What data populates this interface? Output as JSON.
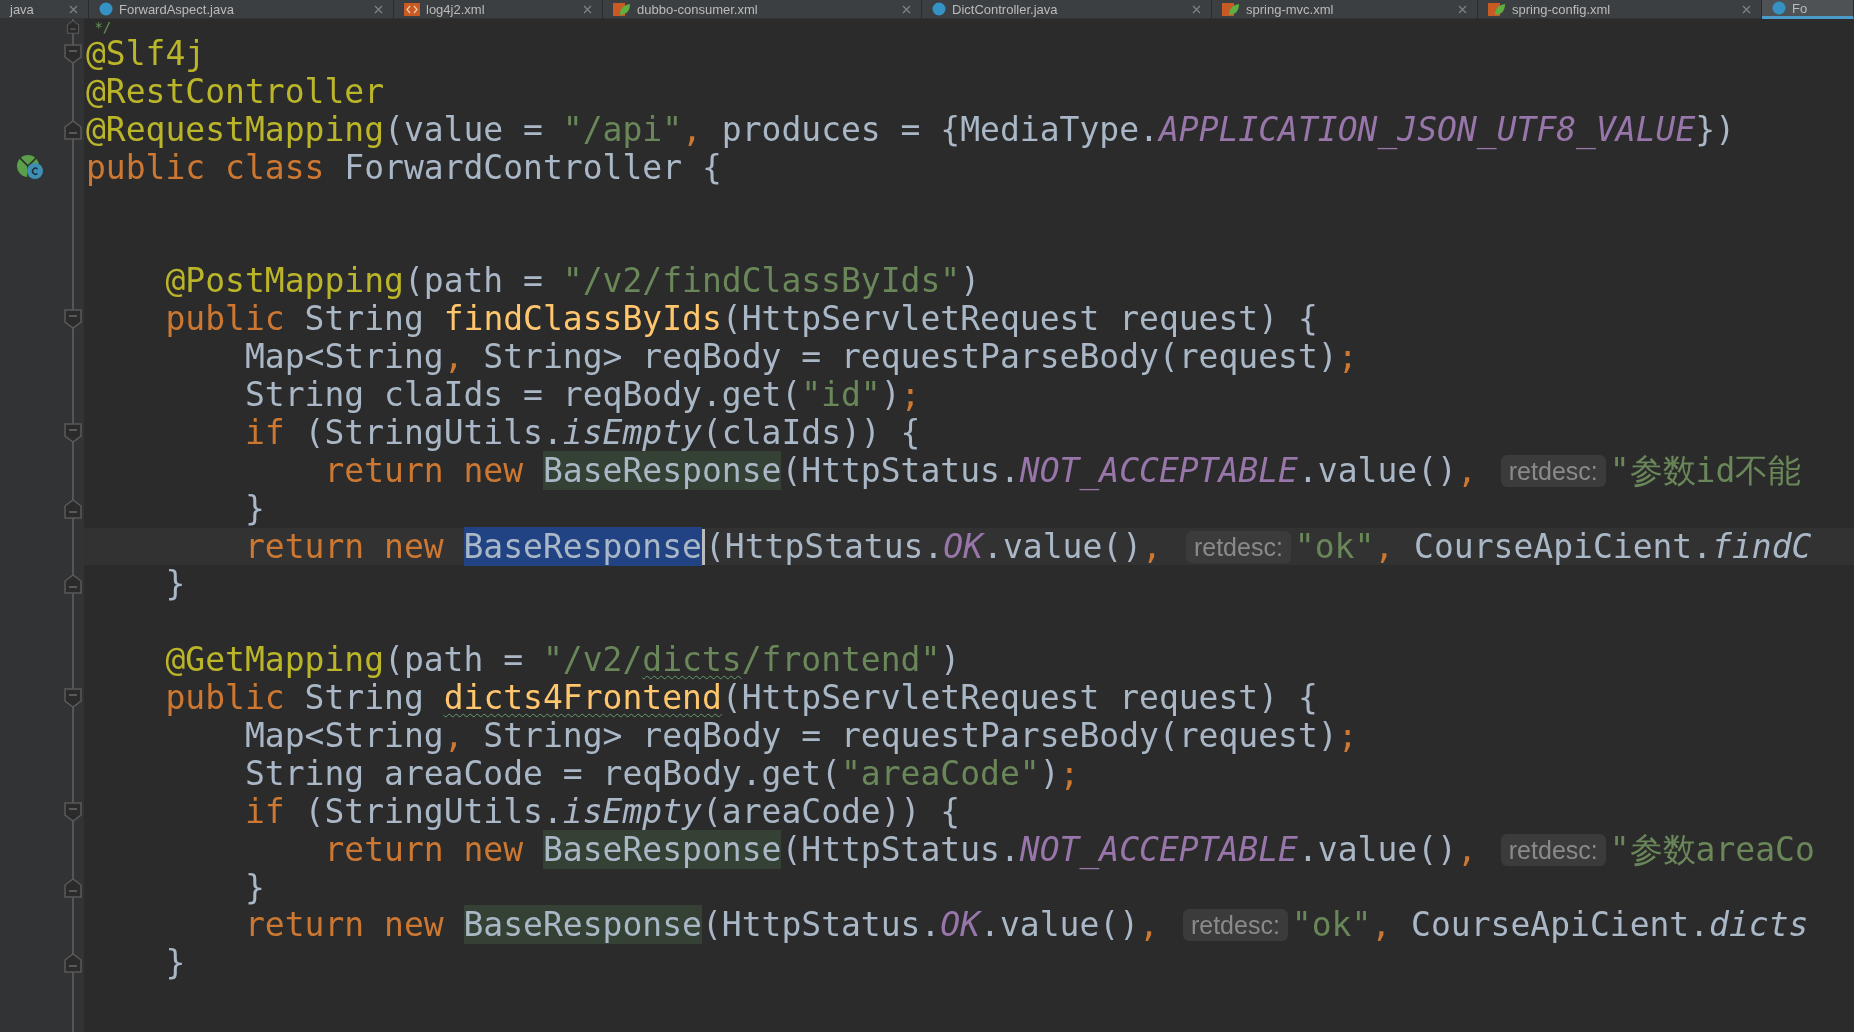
{
  "tabs": [
    {
      "label": "java",
      "kind": "plain",
      "selected": false
    },
    {
      "label": "ForwardAspect.java",
      "kind": "java",
      "selected": false
    },
    {
      "label": "log4j2.xml",
      "kind": "xml",
      "selected": false
    },
    {
      "label": "dubbo-consumer.xml",
      "kind": "spring",
      "selected": false
    },
    {
      "label": "DictController.java",
      "kind": "java",
      "selected": false
    },
    {
      "label": "spring-mvc.xml",
      "kind": "spring",
      "selected": false
    },
    {
      "label": "spring-config.xml",
      "kind": "spring",
      "selected": false
    },
    {
      "label": "Fo",
      "kind": "java",
      "selected": true
    }
  ],
  "lines": [
    {
      "fold_start": false,
      "fold_end": true,
      "class_icon": false,
      "tokens": [
        {
          "kind": "comment",
          "text": " */"
        }
      ]
    },
    {
      "fold_start": true,
      "fold_end": false,
      "class_icon": false,
      "tokens": [
        {
          "kind": "annotation",
          "text": "@Slf4j"
        }
      ]
    },
    {
      "fold_start": false,
      "fold_end": false,
      "class_icon": false,
      "tokens": [
        {
          "kind": "annotation",
          "text": "@RestController"
        }
      ]
    },
    {
      "fold_start": false,
      "fold_end": true,
      "class_icon": false,
      "tokens": [
        {
          "kind": "annotation",
          "text": "@RequestMapping"
        },
        {
          "kind": "plain",
          "text": "(value = "
        },
        {
          "kind": "string",
          "text": "\"/api\""
        },
        {
          "kind": "punct",
          "text": ","
        },
        {
          "kind": "plain",
          "text": " produces = {MediaType."
        },
        {
          "kind": "constant",
          "text": "APPLICATION_JSON_UTF8_VALUE"
        },
        {
          "kind": "plain",
          "text": "})"
        }
      ]
    },
    {
      "fold_start": false,
      "fold_end": false,
      "class_icon": true,
      "tokens": [
        {
          "kind": "keyword",
          "text": "public class"
        },
        {
          "kind": "plain",
          "text": " ForwardController {"
        }
      ]
    },
    {
      "fold_start": false,
      "fold_end": false,
      "class_icon": false
    },
    {
      "fold_start": false,
      "fold_end": false,
      "class_icon": false
    },
    {
      "fold_start": false,
      "fold_end": false,
      "class_icon": false,
      "tokens": [
        {
          "kind": "annotation",
          "text": "    @PostMapping"
        },
        {
          "kind": "plain",
          "text": "(path = "
        },
        {
          "kind": "string",
          "text": "\"/v2/findClassByIds\""
        },
        {
          "kind": "plain",
          "text": ")"
        }
      ]
    },
    {
      "fold_start": true,
      "fold_end": false,
      "class_icon": false,
      "tokens": [
        {
          "kind": "keyword",
          "text": "    public"
        },
        {
          "kind": "plain",
          "text": " String "
        },
        {
          "kind": "method",
          "text": "findClassByIds"
        },
        {
          "kind": "plain",
          "text": "(HttpServletRequest request) {"
        }
      ]
    },
    {
      "fold_start": false,
      "fold_end": false,
      "class_icon": false,
      "tokens": [
        {
          "kind": "plain",
          "text": "        Map<String"
        },
        {
          "kind": "punct",
          "text": ","
        },
        {
          "kind": "plain",
          "text": " String> reqBody = requestParseBody(request)"
        },
        {
          "kind": "punct",
          "text": ";"
        }
      ]
    },
    {
      "fold_start": false,
      "fold_end": false,
      "class_icon": false,
      "tokens": [
        {
          "kind": "plain",
          "text": "        String claIds = reqBody.get("
        },
        {
          "kind": "string",
          "text": "\"id\""
        },
        {
          "kind": "plain",
          "text": ")"
        },
        {
          "kind": "punct",
          "text": ";"
        }
      ]
    },
    {
      "fold_start": true,
      "fold_end": false,
      "class_icon": false,
      "tokens": [
        {
          "kind": "keyword",
          "text": "        if"
        },
        {
          "kind": "plain",
          "text": " (StringUtils."
        },
        {
          "kind": "static",
          "text": "isEmpty"
        },
        {
          "kind": "plain",
          "text": "(claIds)) {"
        }
      ]
    },
    {
      "fold_start": false,
      "fold_end": false,
      "class_icon": false,
      "tokens": [
        {
          "kind": "keyword",
          "text": "            return new "
        },
        {
          "kind": "usage",
          "text": "BaseResponse"
        },
        {
          "kind": "plain",
          "text": "(HttpStatus."
        },
        {
          "kind": "constant",
          "text": "NOT_ACCEPTABLE"
        },
        {
          "kind": "plain",
          "text": ".value()"
        },
        {
          "kind": "punct",
          "text": ","
        },
        {
          "kind": "hint",
          "text": "retdesc:"
        },
        {
          "kind": "string",
          "text": "\"参数id不能"
        }
      ]
    },
    {
      "fold_start": false,
      "fold_end": true,
      "class_icon": false,
      "tokens": [
        {
          "kind": "plain",
          "text": "        }"
        }
      ]
    },
    {
      "fold_start": false,
      "fold_end": false,
      "class_icon": false,
      "current": true,
      "tokens": [
        {
          "kind": "keyword",
          "text": "        return new "
        },
        {
          "kind": "selected",
          "text": "BaseResponse"
        },
        {
          "kind": "plain",
          "text": "(HttpStatus."
        },
        {
          "kind": "constant",
          "text": "OK"
        },
        {
          "kind": "plain",
          "text": ".value()"
        },
        {
          "kind": "punct",
          "text": ","
        },
        {
          "kind": "hint",
          "text": "retdesc:"
        },
        {
          "kind": "string",
          "text": "\"ok\""
        },
        {
          "kind": "punct",
          "text": ","
        },
        {
          "kind": "plain",
          "text": " CourseApiCient."
        },
        {
          "kind": "static",
          "text": "findC"
        }
      ]
    },
    {
      "fold_start": false,
      "fold_end": true,
      "class_icon": false,
      "tokens": [
        {
          "kind": "plain",
          "text": "    }"
        }
      ]
    },
    {
      "fold_start": false,
      "fold_end": false,
      "class_icon": false
    },
    {
      "fold_start": false,
      "fold_end": false,
      "class_icon": false,
      "tokens": [
        {
          "kind": "annotation",
          "text": "    @GetMapping"
        },
        {
          "kind": "plain",
          "text": "(path = "
        },
        {
          "kind": "string",
          "text": "\"/v2/"
        },
        {
          "kind": "typo_string",
          "text": "dicts"
        },
        {
          "kind": "string",
          "text": "/frontend\""
        },
        {
          "kind": "plain",
          "text": ")"
        }
      ]
    },
    {
      "fold_start": true,
      "fold_end": false,
      "class_icon": false,
      "tokens": [
        {
          "kind": "keyword",
          "text": "    public"
        },
        {
          "kind": "plain",
          "text": " String "
        },
        {
          "kind": "typo_method",
          "text": "dicts4Frontend"
        },
        {
          "kind": "plain",
          "text": "(HttpServletRequest request) {"
        }
      ]
    },
    {
      "fold_start": false,
      "fold_end": false,
      "class_icon": false,
      "tokens": [
        {
          "kind": "plain",
          "text": "        Map<String"
        },
        {
          "kind": "punct",
          "text": ","
        },
        {
          "kind": "plain",
          "text": " String> reqBody = requestParseBody(request)"
        },
        {
          "kind": "punct",
          "text": ";"
        }
      ]
    },
    {
      "fold_start": false,
      "fold_end": false,
      "class_icon": false,
      "tokens": [
        {
          "kind": "plain",
          "text": "        String areaCode = reqBody.get("
        },
        {
          "kind": "string",
          "text": "\"areaCode\""
        },
        {
          "kind": "plain",
          "text": ")"
        },
        {
          "kind": "punct",
          "text": ";"
        }
      ]
    },
    {
      "fold_start": true,
      "fold_end": false,
      "class_icon": false,
      "tokens": [
        {
          "kind": "keyword",
          "text": "        if"
        },
        {
          "kind": "plain",
          "text": " (StringUtils."
        },
        {
          "kind": "static",
          "text": "isEmpty"
        },
        {
          "kind": "plain",
          "text": "(areaCode)) {"
        }
      ]
    },
    {
      "fold_start": false,
      "fold_end": false,
      "class_icon": false,
      "tokens": [
        {
          "kind": "keyword",
          "text": "            return new "
        },
        {
          "kind": "usage",
          "text": "BaseResponse"
        },
        {
          "kind": "plain",
          "text": "(HttpStatus."
        },
        {
          "kind": "constant",
          "text": "NOT_ACCEPTABLE"
        },
        {
          "kind": "plain",
          "text": ".value()"
        },
        {
          "kind": "punct",
          "text": ","
        },
        {
          "kind": "hint",
          "text": "retdesc:"
        },
        {
          "kind": "string",
          "text": "\"参数areaCo"
        }
      ]
    },
    {
      "fold_start": false,
      "fold_end": true,
      "class_icon": false,
      "tokens": [
        {
          "kind": "plain",
          "text": "        }"
        }
      ]
    },
    {
      "fold_start": false,
      "fold_end": false,
      "class_icon": false,
      "tokens": [
        {
          "kind": "keyword",
          "text": "        return new "
        },
        {
          "kind": "usage",
          "text": "BaseResponse"
        },
        {
          "kind": "plain",
          "text": "(HttpStatus."
        },
        {
          "kind": "constant",
          "text": "OK"
        },
        {
          "kind": "plain",
          "text": ".value()"
        },
        {
          "kind": "punct",
          "text": ","
        },
        {
          "kind": "hint",
          "text": "retdesc:"
        },
        {
          "kind": "string",
          "text": "\"ok\""
        },
        {
          "kind": "punct",
          "text": ","
        },
        {
          "kind": "plain",
          "text": " CourseApiCient."
        },
        {
          "kind": "static",
          "text": "dicts"
        }
      ]
    },
    {
      "fold_start": false,
      "fold_end": true,
      "class_icon": false,
      "tokens": [
        {
          "kind": "plain",
          "text": "    }"
        }
      ]
    }
  ]
}
